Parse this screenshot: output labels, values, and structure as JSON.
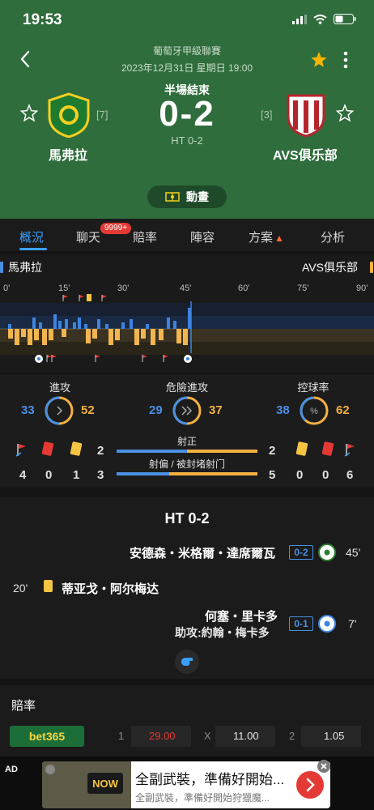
{
  "status_bar": {
    "time": "19:53"
  },
  "match": {
    "league": "葡萄牙甲級聯賽",
    "datetime": "2023年12月31日 星期日 19:00",
    "status": "半場結束",
    "score": "0-2",
    "half_time": "HT 0-2",
    "animation_label": "動畫",
    "home": {
      "name": "馬弗拉",
      "rank": "[7]"
    },
    "away": {
      "name": "AVS俱乐部",
      "rank": "[3]"
    }
  },
  "tabs": [
    {
      "label": "概況",
      "active": true
    },
    {
      "label": "聊天",
      "badge": "9999+"
    },
    {
      "label": "賠率"
    },
    {
      "label": "陣容"
    },
    {
      "label": "方案"
    },
    {
      "label": "分析"
    }
  ],
  "timeline": {
    "home_name": "馬弗拉",
    "away_name": "AVS俱乐部",
    "ticks": [
      "0'",
      "15'",
      "30'",
      "45'",
      "60'",
      "75'",
      "90'"
    ]
  },
  "stats": {
    "attack": {
      "label": "進攻",
      "home": "33",
      "away": "52"
    },
    "dangerous": {
      "label": "危險進攻",
      "home": "29",
      "away": "37"
    },
    "possession": {
      "label": "控球率",
      "home": "38",
      "away": "62",
      "home_fraction": 0.38
    },
    "home_events": {
      "corners": "4",
      "red": "0",
      "yellow": "1"
    },
    "away_events": {
      "corners": "6",
      "red": "0",
      "yellow": "0"
    },
    "on_target": {
      "label": "射正",
      "home": "2",
      "away": "2"
    },
    "off_target": {
      "label": "射偏 / 被封堵射门",
      "home": "3",
      "away": "5"
    },
    "colors": {
      "home": "#4a90e2",
      "away": "#f5b041"
    }
  },
  "events": {
    "title": "HT 0-2",
    "list": [
      {
        "side": "away",
        "player": "安德森・米格爾・達席爾瓦",
        "score": "0-2",
        "minute": "45'",
        "type": "goal"
      },
      {
        "side": "home",
        "player": "蒂亚戈・阿尔梅达",
        "minute": "20'",
        "type": "yellow"
      },
      {
        "side": "away",
        "player": "何塞・里卡多",
        "assist": "助攻:約翰・梅卡多",
        "score": "0-1",
        "minute": "7'",
        "type": "goal"
      }
    ],
    "kickoff_icon": "whistle-icon"
  },
  "odds": {
    "title": "賠率",
    "bookmaker": "bet365",
    "home_idx": "1",
    "home_val": "29.00",
    "draw_idx": "X",
    "draw_val": "11.00",
    "away_idx": "2",
    "away_val": "1.05"
  },
  "ad": {
    "tag": "AD",
    "title": "全副武裝，準備好開始...",
    "desc": "全副武裝，準備好開始狩獵魔..."
  }
}
